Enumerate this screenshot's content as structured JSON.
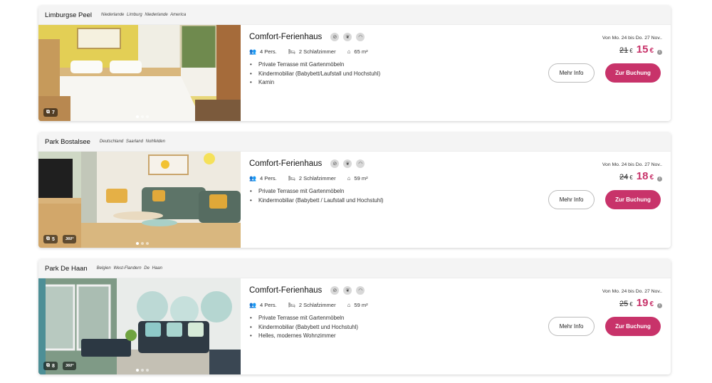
{
  "listings": [
    {
      "park": "Limburgse Peel",
      "location": "Niederlande  Limburg  Niederlande America",
      "photo_count": "7",
      "has_360": false,
      "title": "Comfort-Ferienhaus",
      "persons": "4 Pers.",
      "bedrooms": "2 Schlafzimmer",
      "area": "65 m²",
      "features": [
        "Private Terrasse mit Gartenmöbeln",
        "Kindermobiliar (Babybett/Laufstall und Hochstuhl)",
        "Kamin"
      ],
      "date_range": "Von Mo. 24 bis Do. 27 Nov..",
      "old_price": "21",
      "new_price": "15",
      "currency": "€",
      "more_label": "Mehr Info",
      "book_label": "Zur Buchung"
    },
    {
      "park": "Park Bostalsee",
      "location": "Deutschland  Saarland  Nohfelden",
      "photo_count": "5",
      "has_360": true,
      "badge_360": "360°",
      "title": "Comfort-Ferienhaus",
      "persons": "4 Pers.",
      "bedrooms": "2 Schlafzimmer",
      "area": "59 m²",
      "features": [
        "Private Terrasse mit Gartenmöbeln",
        "Kindermobiliar (Babybett / Laufstall und Hochstuhl)"
      ],
      "date_range": "Von Mo. 24 bis Do. 27 Nov..",
      "old_price": "24",
      "new_price": "18",
      "currency": "€",
      "more_label": "Mehr Info",
      "book_label": "Zur Buchung"
    },
    {
      "park": "Park De Haan",
      "location": "Belgien  West-Flandern  De Haan",
      "photo_count": "8",
      "has_360": true,
      "badge_360": "360°",
      "title": "Comfort-Ferienhaus",
      "persons": "4 Pers.",
      "bedrooms": "2 Schlafzimmer",
      "area": "59 m²",
      "features": [
        "Private Terrasse mit Gartenmöbeln",
        "Kindermobiliar (Babybett und Hochstuhl)",
        "Helles, modernes Wohnzimmer"
      ],
      "date_range": "Von Mo. 24 bis Do. 27 Nov..",
      "old_price": "25",
      "new_price": "19",
      "currency": "€",
      "more_label": "Mehr Info",
      "book_label": "Zur Buchung"
    }
  ],
  "icons": {
    "amenities": [
      "no-smoking-icon",
      "pets-icon",
      "wifi-icon"
    ],
    "persons": "persons-icon",
    "bedrooms": "bed-icon",
    "area": "house-icon",
    "photos": "gallery-icon",
    "info": "info-icon"
  },
  "colors": {
    "accent": "#c8336a",
    "header_bg": "#f4f4f4"
  }
}
